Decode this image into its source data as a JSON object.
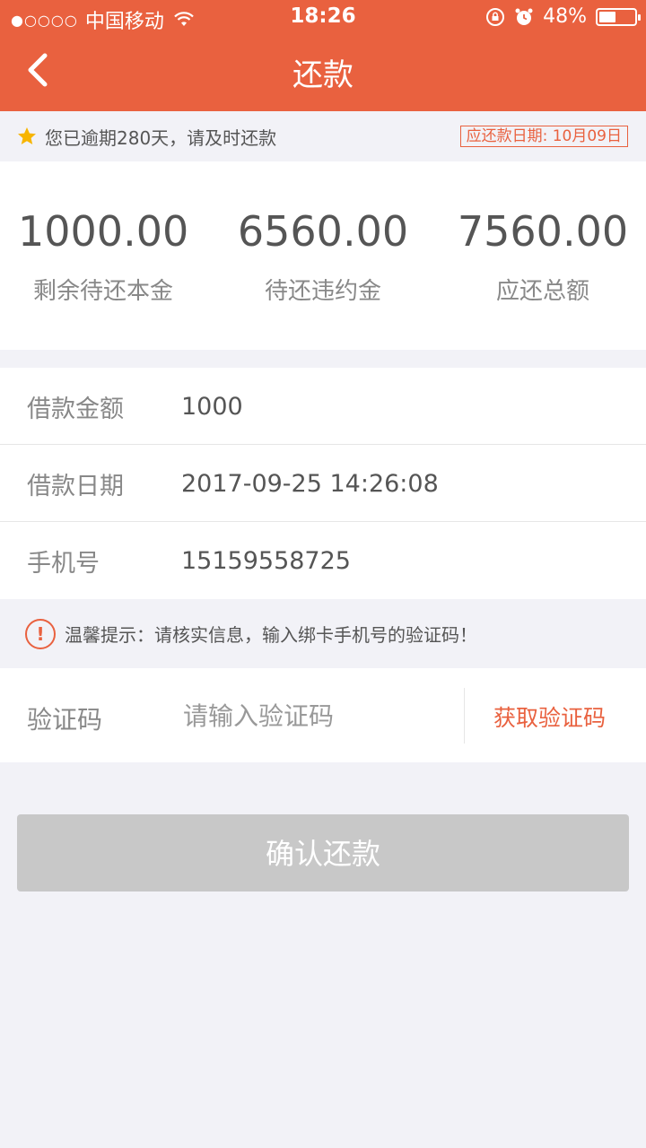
{
  "status_bar": {
    "signal_dots": "●○○○○",
    "carrier": "中国移动",
    "time": "18:26",
    "battery_percent": "48%",
    "battery_level": 0.48
  },
  "nav": {
    "title": "还款"
  },
  "notice": {
    "text": "您已逾期280天，请及时还款",
    "due_date": "应还款日期: 10月09日"
  },
  "summary": {
    "items": [
      {
        "value": "1000.00",
        "label": "剩余待还本金"
      },
      {
        "value": "6560.00",
        "label": "待还违约金"
      },
      {
        "value": "7560.00",
        "label": "应还总额"
      }
    ]
  },
  "info": {
    "rows": [
      {
        "key": "借款金额",
        "value": "1000"
      },
      {
        "key": "借款日期",
        "value": "2017-09-25 14:26:08"
      },
      {
        "key": "手机号",
        "value": "15159558725"
      }
    ]
  },
  "tip": {
    "icon": "!",
    "text": "温馨提示：请核实信息，输入绑卡手机号的验证码！"
  },
  "code": {
    "label": "验证码",
    "placeholder": "请输入验证码",
    "get_code": "获取验证码"
  },
  "confirm": {
    "label": "确认还款"
  },
  "colors": {
    "accent": "#e9613f",
    "disabled": "#c8c8c8"
  }
}
